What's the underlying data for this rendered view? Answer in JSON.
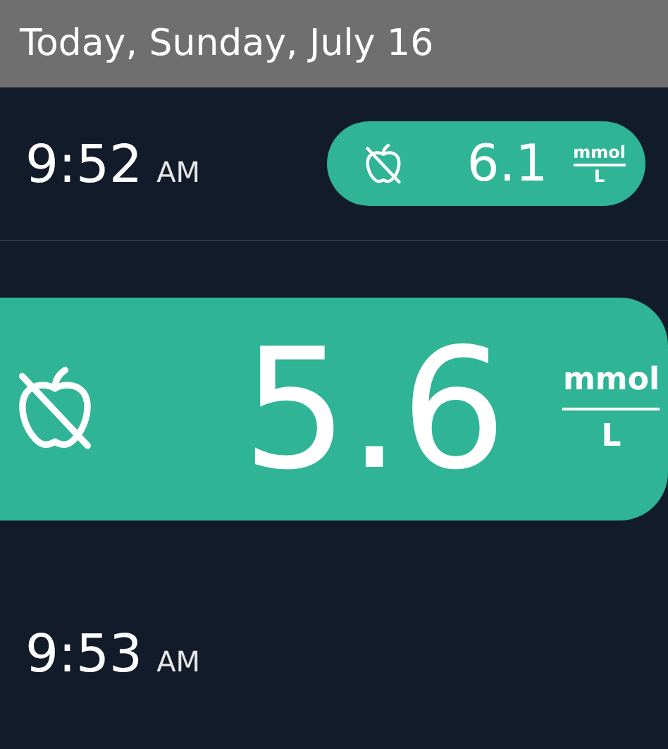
{
  "header": {
    "title": "Today, Sunday, July 16"
  },
  "entries": [
    {
      "kind": "log",
      "time": "9:52",
      "period": "AM",
      "reading": {
        "value": "6.1",
        "unit_top": "mmol",
        "unit_bottom": "L"
      }
    },
    {
      "kind": "highlight",
      "reading": {
        "value": "5.6",
        "unit_top": "mmol",
        "unit_bottom": "L"
      }
    },
    {
      "kind": "log",
      "time": "9:53",
      "period": "AM"
    }
  ]
}
